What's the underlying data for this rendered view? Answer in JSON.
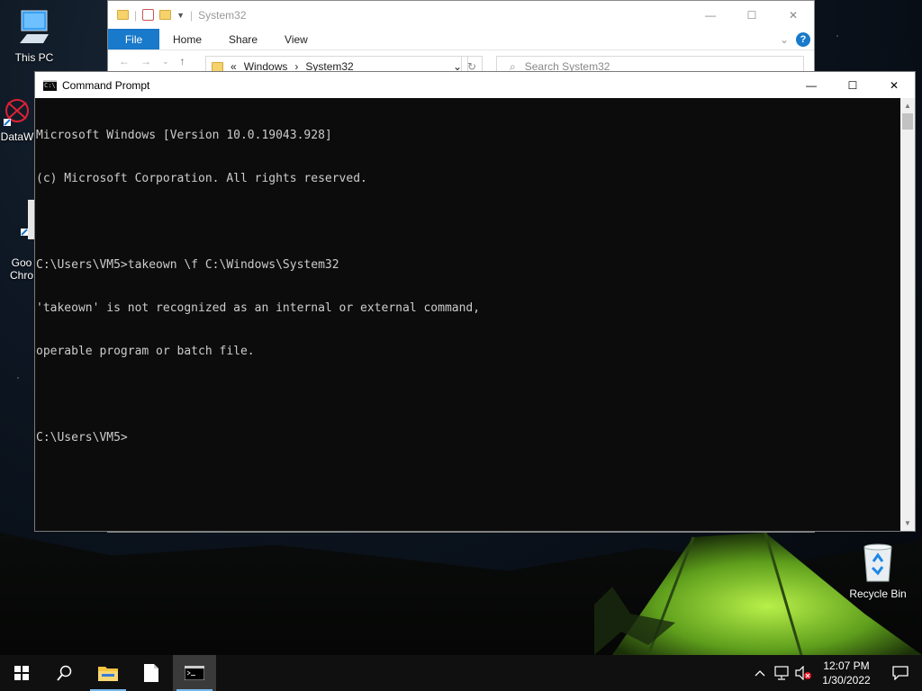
{
  "desktop": {
    "icons": [
      {
        "label": "This PC"
      },
      {
        "label": "DataW"
      },
      {
        "label": "Goo\nChro"
      },
      {
        "label": "Recycle Bin"
      }
    ]
  },
  "explorer": {
    "title": "System32",
    "ribbon_tabs": [
      "File",
      "Home",
      "Share",
      "View"
    ],
    "address_parts": [
      "Windows",
      "System32"
    ],
    "address_prefix": "«",
    "search_placeholder": "Search System32"
  },
  "cmd": {
    "title": "Command Prompt",
    "lines": [
      "Microsoft Windows [Version 10.0.19043.928]",
      "(c) Microsoft Corporation. All rights reserved.",
      "",
      "C:\\Users\\VM5>takeown \\f C:\\Windows\\System32",
      "'takeown' is not recognized as an internal or external command,",
      "operable program or batch file.",
      "",
      "C:\\Users\\VM5>"
    ]
  },
  "taskbar": {
    "time": "12:07 PM",
    "date": "1/30/2022"
  },
  "colors": {
    "accent": "#1979ca",
    "console_bg": "#0c0c0c",
    "console_fg": "#cccccc",
    "taskbar_bg": "#101010"
  }
}
